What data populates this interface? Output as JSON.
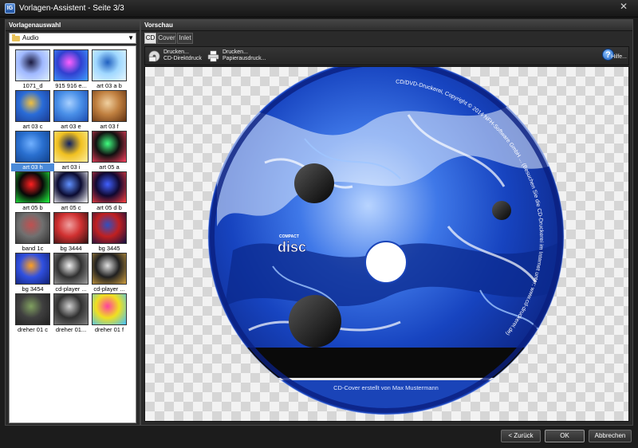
{
  "window": {
    "title": "Vorlagen-Assistent - Seite 3/3",
    "app_icon": "IG",
    "close": "✕"
  },
  "left_panel": {
    "title": "Vorlagenauswahl",
    "category": "Audio",
    "templates": [
      {
        "label": "1071_d",
        "colors": [
          "#9fb8ff",
          "#1a1a40",
          "#e0f0ff"
        ]
      },
      {
        "label": "915 916 e...",
        "colors": [
          "#3040d0",
          "#ff60ff",
          "#40a0ff"
        ]
      },
      {
        "label": "art 03 a b",
        "colors": [
          "#a0d8ff",
          "#2060c0",
          "#e8f8ff"
        ]
      },
      {
        "label": "art 03 c",
        "colors": [
          "#2a6cd8",
          "#f0c040",
          "#1a3a90"
        ]
      },
      {
        "label": "art 03 e",
        "colors": [
          "#4a90e8",
          "#a8d0ff",
          "#1a4ab0"
        ]
      },
      {
        "label": "art 03 f",
        "colors": [
          "#c08040",
          "#f0d0a0",
          "#603010"
        ]
      },
      {
        "label": "art 03 h",
        "colors": [
          "#2a70d0",
          "#70b0ff",
          "#10408a"
        ]
      },
      {
        "label": "art 03 i",
        "colors": [
          "#f0c020",
          "#102060",
          "#fff0a0"
        ]
      },
      {
        "label": "art 05 a",
        "colors": [
          "#101010",
          "#40ff80",
          "#ff4060"
        ]
      },
      {
        "label": "art 05 b",
        "colors": [
          "#080808",
          "#ff2020",
          "#20ff40"
        ]
      },
      {
        "label": "art 05 c",
        "colors": [
          "#0a0a30",
          "#6090ff",
          "#ffffff"
        ]
      },
      {
        "label": "art 05 d b",
        "colors": [
          "#100830",
          "#4060ff",
          "#ff4040"
        ]
      },
      {
        "label": "band 1c",
        "colors": [
          "#707070",
          "#c05050",
          "#303030"
        ]
      },
      {
        "label": "bg 3444",
        "colors": [
          "#d03030",
          "#f0a0a0",
          "#301010"
        ]
      },
      {
        "label": "bg 3445",
        "colors": [
          "#c02020",
          "#3050c0",
          "#101040"
        ]
      },
      {
        "label": "bg 3454",
        "colors": [
          "#3050e0",
          "#ffa020",
          "#102070"
        ]
      },
      {
        "label": "cd-player ...",
        "colors": [
          "#303030",
          "#f0f0f0",
          "#a0a0a0"
        ]
      },
      {
        "label": "cd-player ...",
        "colors": [
          "#202020",
          "#e0e0e0",
          "#d0a040"
        ]
      },
      {
        "label": "dreher 01 c",
        "colors": [
          "#404040",
          "#80a060",
          "#202020"
        ]
      },
      {
        "label": "dreher 01...",
        "colors": [
          "#303030",
          "#d0d0d0",
          "#808080"
        ]
      },
      {
        "label": "dreher 01 f",
        "colors": [
          "#f0e020",
          "#ff40a0",
          "#40c0ff"
        ]
      }
    ],
    "selected_index": 6
  },
  "right_panel": {
    "title": "Vorschau",
    "tabs": [
      "CD",
      "Cover",
      "Inlet"
    ],
    "active_tab": 0,
    "toolbar": {
      "print_direct": {
        "line1": "Drucken...",
        "line2": "CD-Direktdruck"
      },
      "print_paper": {
        "line1": "Drucken...",
        "line2": "Papierausdruck..."
      },
      "help": "Hilfe..."
    },
    "disc": {
      "logo_small": "COMPACT",
      "logo_big": "disc",
      "footer": "CD-Cover erstellt von Max Mustermann",
      "rim_text": "CD/DVD-Druckerei, Copyright © 2014 NFH-Software GmbH ... (Besuchen Sie die CD-Druckerei im Internet unter: www.cd-druckerei.de)"
    }
  },
  "buttons": {
    "back": "< Zurück",
    "ok": "OK",
    "cancel": "Abbrechen"
  }
}
